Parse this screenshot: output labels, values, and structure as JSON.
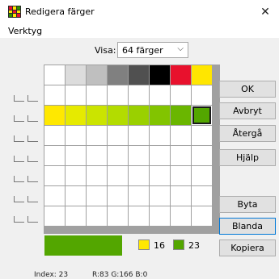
{
  "window": {
    "title": "Redigera färger",
    "close_glyph": "✕"
  },
  "menu": {
    "items": [
      "Verktyg"
    ]
  },
  "visa": {
    "label": "Visa:",
    "value": "64 färger",
    "arrow": "⌵"
  },
  "palette": {
    "rows": [
      [
        "#ffffff",
        "#dcdcdc",
        "#bfbfbf",
        "#808080",
        "#505050",
        "#000000",
        "#e8112d",
        "#ffe600"
      ],
      [
        "#ffffff",
        "#ffffff",
        "#ffffff",
        "#ffffff",
        "#ffffff",
        "#ffffff",
        "#ffffff",
        "#ffffff"
      ],
      [
        "#ffe800",
        "#e6ea00",
        "#cbe400",
        "#b3dc00",
        "#9ad000",
        "#82c400",
        "#6ab600",
        "#53a600"
      ],
      [
        "#ffffff",
        "#ffffff",
        "#ffffff",
        "#ffffff",
        "#ffffff",
        "#ffffff",
        "#ffffff",
        "#ffffff"
      ],
      [
        "#ffffff",
        "#ffffff",
        "#ffffff",
        "#ffffff",
        "#ffffff",
        "#ffffff",
        "#ffffff",
        "#ffffff"
      ],
      [
        "#ffffff",
        "#ffffff",
        "#ffffff",
        "#ffffff",
        "#ffffff",
        "#ffffff",
        "#ffffff",
        "#ffffff"
      ],
      [
        "#ffffff",
        "#ffffff",
        "#ffffff",
        "#ffffff",
        "#ffffff",
        "#ffffff",
        "#ffffff",
        "#ffffff"
      ],
      [
        "#ffffff",
        "#ffffff",
        "#ffffff",
        "#ffffff",
        "#ffffff",
        "#ffffff",
        "#ffffff",
        "#ffffff"
      ]
    ],
    "selected_row": 2,
    "selected_col": 7
  },
  "swatches": {
    "current_color": "#53a600",
    "from_color": "#ffe800",
    "from_number": "16",
    "to_color": "#53a600",
    "to_number": "23"
  },
  "status": {
    "index": "Index: 23",
    "rgb": "R:83  G:166  B:0"
  },
  "buttons": {
    "ok": "OK",
    "cancel": "Avbryt",
    "revert": "Återgå",
    "help": "Hjälp",
    "swap": "Byta",
    "mix": "Blanda",
    "copy": "Kopiera"
  }
}
